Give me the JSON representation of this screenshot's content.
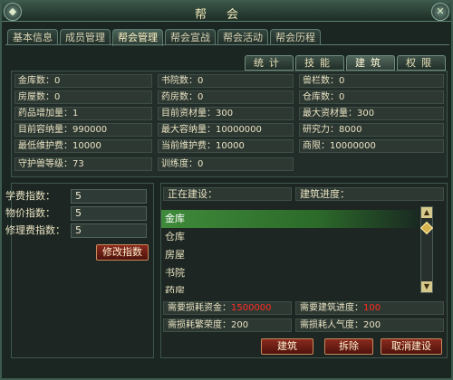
{
  "window": {
    "title": "帮会"
  },
  "top_tabs": [
    "基本信息",
    "成员管理",
    "帮会管理",
    "帮会宣战",
    "帮会活动",
    "帮会历程"
  ],
  "sub_tabs": [
    "统计",
    "技能",
    "建筑",
    "权限"
  ],
  "info": {
    "row1": [
      "金库数：0",
      "书院数：0",
      "兽栏数：0"
    ],
    "row2": [
      "房屋数：0",
      "药房数：0",
      "仓库数：0"
    ],
    "row3": [
      "药品增加量：1",
      "目前资材量：300",
      "最大资材量：300"
    ],
    "row4": [
      "目前容纳量：990000",
      "最大容纳量：10000000",
      "研究力：8000"
    ],
    "row5": [
      "最低维护费：10000",
      "当前维护费：10000",
      "商限：10000000"
    ],
    "row6": [
      "守护兽等级：73",
      "训练度：0"
    ]
  },
  "fees": {
    "tuition_label": "学费指数：",
    "tuition_value": "5",
    "price_label": "物价指数：",
    "price_value": "5",
    "repair_label": "修理费指数：",
    "repair_value": "5",
    "modify_button": "修改指数"
  },
  "building": {
    "in_progress_label": "正在建设：",
    "progress_label": "建筑进度：",
    "items": [
      "金库",
      "仓库",
      "房屋",
      "书院",
      "药房"
    ],
    "selected": "金库",
    "cost_label": "需要损耗资金：",
    "cost_value": "1500000",
    "need_progress_label": "需要建筑进度：",
    "need_progress_value": "100",
    "prosperity_label": "需损耗繁荣度：200",
    "popularity_label": "需损耗人气度：200",
    "build_button": "建筑",
    "demolish_button": "拆除",
    "cancel_button": "取消建设"
  }
}
